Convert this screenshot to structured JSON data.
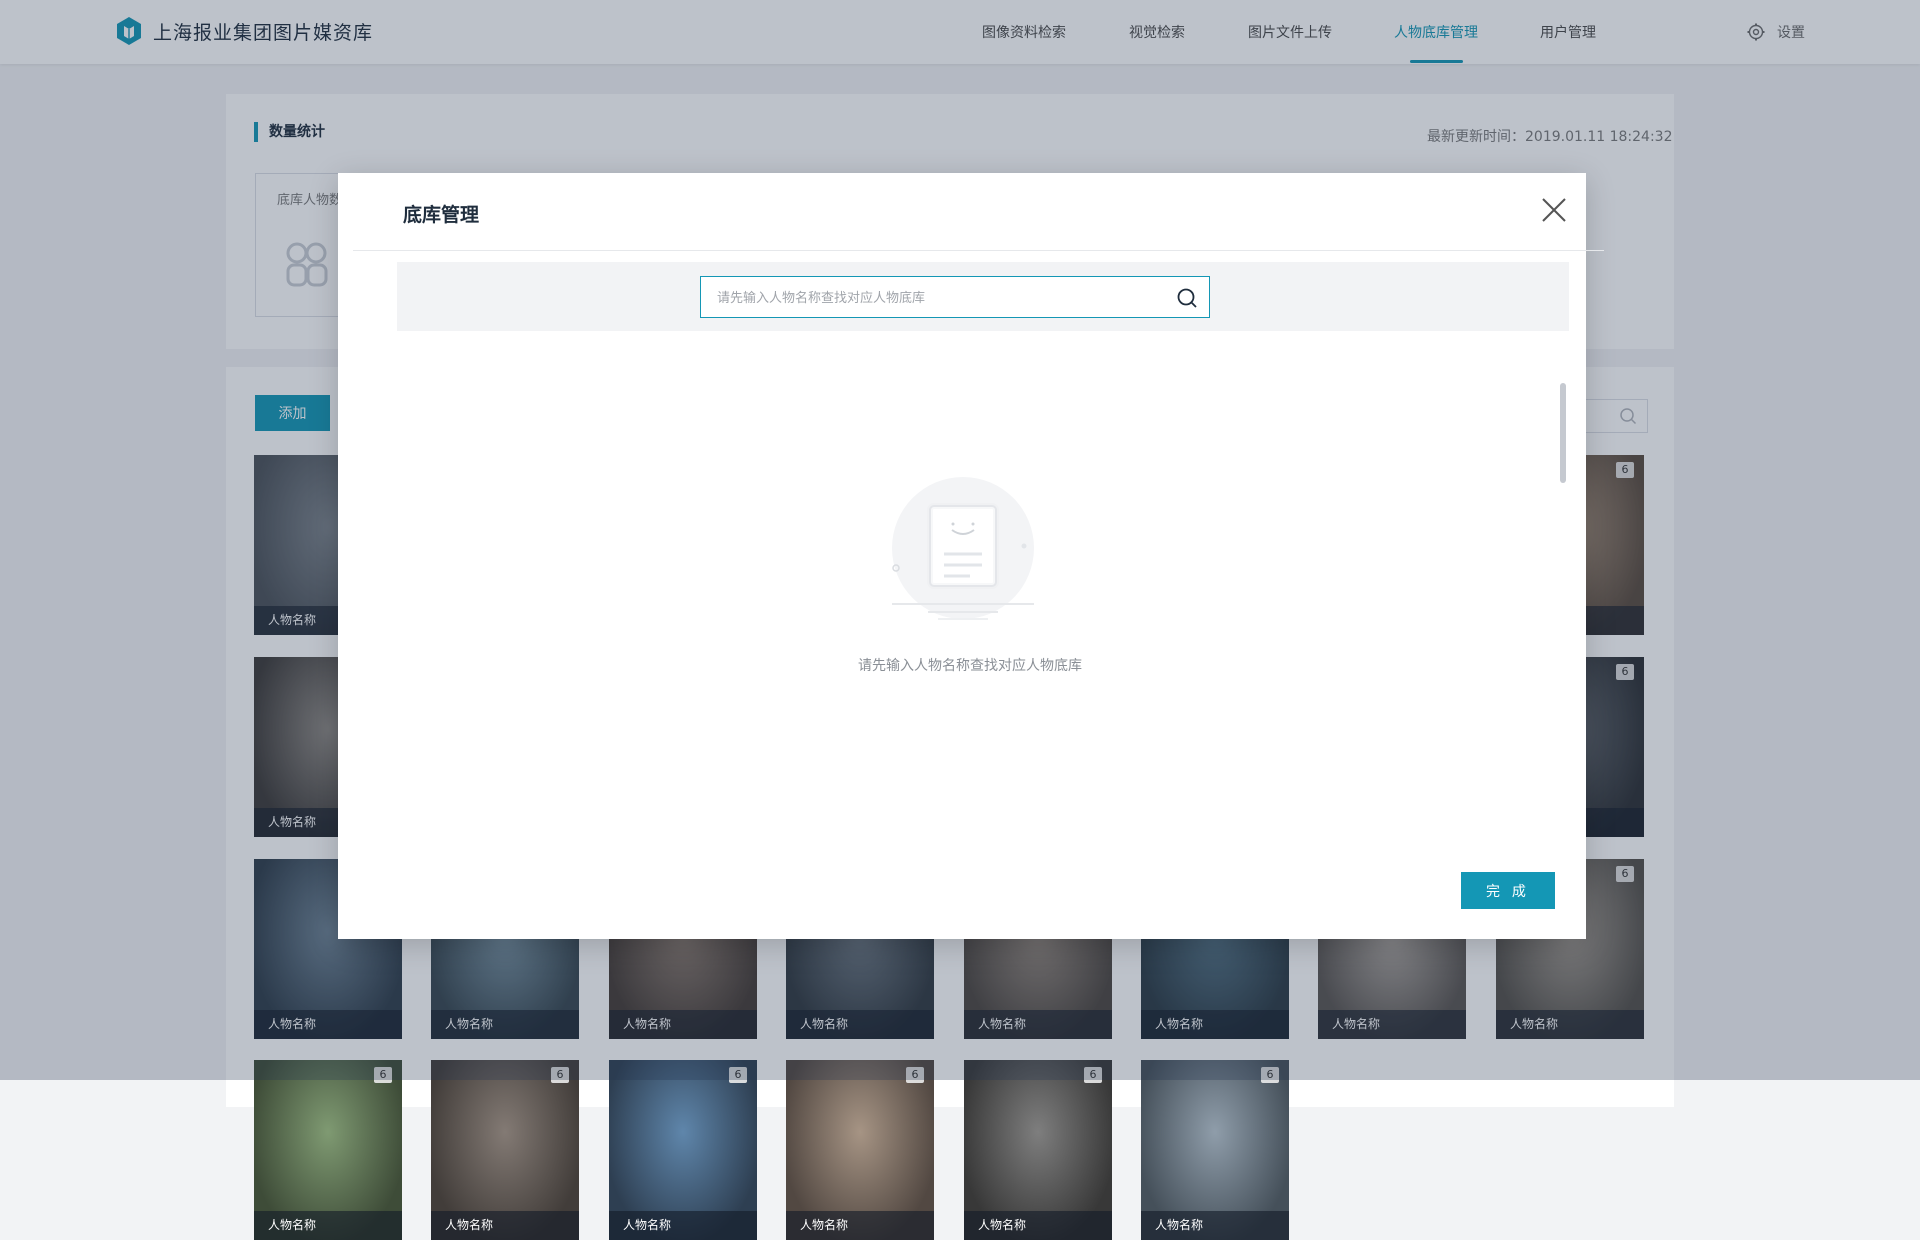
{
  "app": {
    "brand": "上海报业集团图片媒资库"
  },
  "nav": {
    "items": [
      {
        "label": "图像资料检索"
      },
      {
        "label": "视觉检索"
      },
      {
        "label": "图片文件上传"
      },
      {
        "label": "人物底库管理"
      },
      {
        "label": "用户管理"
      }
    ],
    "active": "人物底库管理",
    "settings_label": "设置"
  },
  "stats": {
    "title": "数量统计",
    "update_time": "最新更新时间：2019.01.11 18:24:32",
    "card_label": "底库人物数"
  },
  "list": {
    "add_label": "添加",
    "cards": [
      {
        "name": "人物名称",
        "count": "6"
      },
      {
        "name": "人物名称",
        "count": "6"
      },
      {
        "name": "人物名称",
        "count": "6"
      },
      {
        "name": "人物名称",
        "count": "6"
      },
      {
        "name": "人物名称",
        "count": "6"
      },
      {
        "name": "人物名称",
        "count": "6"
      },
      {
        "name": "人物名称",
        "count": "6"
      },
      {
        "name": "人物名称",
        "count": "6"
      },
      {
        "name": "人物名称",
        "count": "6"
      },
      {
        "name": "人物名称",
        "count": "6"
      },
      {
        "name": "人物名称",
        "count": "6"
      },
      {
        "name": "人物名称",
        "count": "6"
      },
      {
        "name": "人物名称",
        "count": "6"
      },
      {
        "name": "人物名称",
        "count": "6"
      },
      {
        "name": "人物名称",
        "count": "6"
      },
      {
        "name": "人物名称",
        "count": "6"
      },
      {
        "name": "人物名称",
        "count": "6"
      },
      {
        "name": "人物名称",
        "count": "6"
      }
    ]
  },
  "modal": {
    "title": "底库管理",
    "search_placeholder": "请先输入人物名称查找对应人物底库",
    "empty_text": "请先输入人物名称查找对应人物底库",
    "done_label": "完 成"
  },
  "colors": {
    "accent": "#1497b5",
    "overlay": "#263450",
    "panel": "#ffffff",
    "page": "#f2f3f5"
  }
}
